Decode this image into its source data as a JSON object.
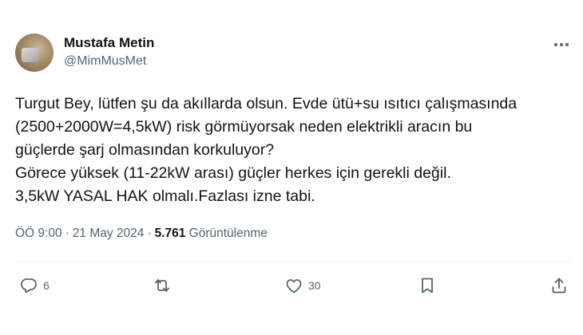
{
  "author": {
    "display_name": "Mustafa Metin",
    "handle": "@MimMusMet"
  },
  "tweet": {
    "lines": [
      "Turgut Bey, lütfen şu da akıllarda olsun. Evde ütü+su ısıtıcı çalışmasında",
      "(2500+2000W=4,5kW) risk görmüyorsak neden elektrikli aracın bu",
      "güçlerde şarj olmasından korkuluyor?",
      "Görece yüksek (11-22kW arası) güçler herkes için gerekli değil.",
      "3,5kW YASAL HAK olmalı.Fazlası izne tabi."
    ]
  },
  "meta": {
    "time": "ÖÖ 9:00",
    "separator": "·",
    "date": "21 May 2024",
    "views_count": "5.761",
    "views_label": "Görüntülenme"
  },
  "actions": {
    "reply_count": "6",
    "like_count": "30"
  },
  "colors": {
    "text": "#0f1419",
    "secondary": "#536471",
    "divider": "#eff3f4"
  },
  "icons": [
    "more-icon",
    "reply-icon",
    "repost-icon",
    "like-icon",
    "bookmark-icon",
    "share-icon"
  ]
}
